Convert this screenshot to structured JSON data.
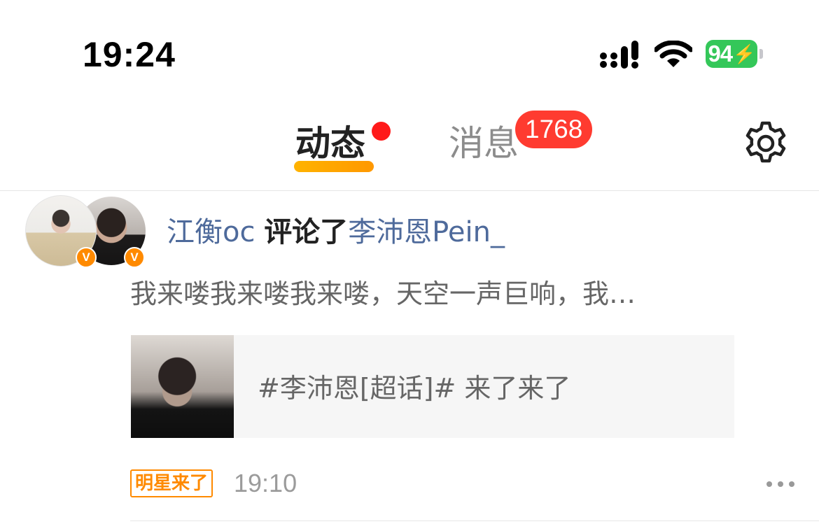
{
  "status_bar": {
    "time": "19:24",
    "battery": "94"
  },
  "header": {
    "tabs": [
      {
        "label": "动态",
        "active": true,
        "has_red_dot": true
      },
      {
        "label": "消息",
        "active": false,
        "badge": "1768"
      }
    ],
    "icons": {
      "settings": "gear-icon"
    }
  },
  "feed": [
    {
      "actor": "江衡oc",
      "action": "评论了",
      "target": "李沛恩Pein_",
      "comment": "我来喽我来喽我来喽，天空一声巨响，我…",
      "card": {
        "text": "#李沛恩[超话]#  来了来了"
      },
      "source_tag": "明星来了",
      "time": "19:10",
      "avatars": [
        {
          "verified_badge": "V"
        },
        {
          "verified_badge": "V"
        }
      ]
    }
  ],
  "colors": {
    "accent_orange": "#ff8a00",
    "badge_red": "#ff3b30",
    "link_blue": "#4e6a9b",
    "battery_green": "#34c759"
  }
}
